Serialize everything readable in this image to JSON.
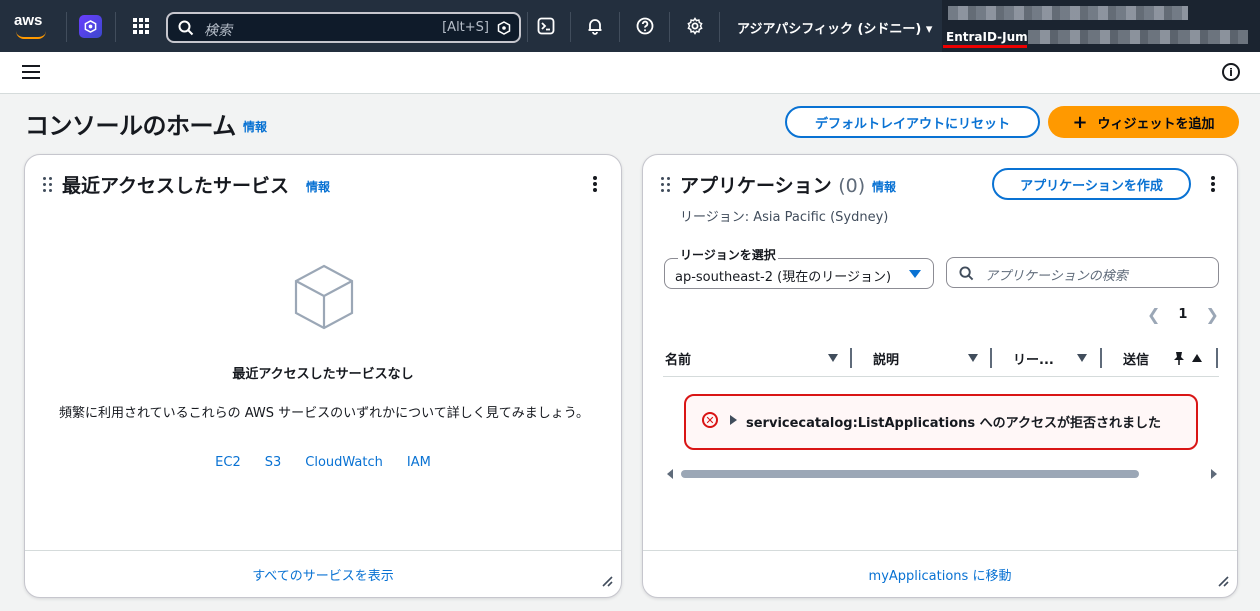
{
  "topnav": {
    "logo_text": "aws",
    "search_placeholder": "検索",
    "search_shortcut": "[Alt+S]",
    "region": "アジアパシフィック (シドニー) ▾",
    "account_name": "EntraID-Jump/"
  },
  "header": {
    "title": "コンソールのホーム",
    "info": "情報",
    "reset_button": "デフォルトレイアウトにリセット",
    "add_widget_button": "ウィジェットを追加"
  },
  "recent": {
    "title": "最近アクセスしたサービス",
    "info": "情報",
    "empty_title": "最近アクセスしたサービスなし",
    "empty_desc": "頻繁に利用されているこれらの AWS サービスのいずれかについて詳しく見てみましょう。",
    "links": [
      "EC2",
      "S3",
      "CloudWatch",
      "IAM"
    ],
    "footer_link": "すべてのサービスを表示"
  },
  "apps": {
    "title": "アプリケーション",
    "count": "(0)",
    "info": "情報",
    "create_button": "アプリケーションを作成",
    "region_subtitle": "リージョン: Asia Pacific (Sydney)",
    "region_label": "リージョンを選択",
    "region_value": "ap-southeast-2 (現在のリージョン)",
    "search_placeholder": "アプリケーションの検索",
    "page_number": "1",
    "columns": [
      "名前",
      "説明",
      "リー...",
      "送信"
    ],
    "error_message": "servicecatalog:ListApplications へのアクセスが拒否されました",
    "footer_link": "myApplications に移動"
  },
  "colors": {
    "nav_bg": "#232f3e",
    "accent": "#0972d3",
    "primary_button": "#ff9900",
    "error": "#d91515"
  }
}
